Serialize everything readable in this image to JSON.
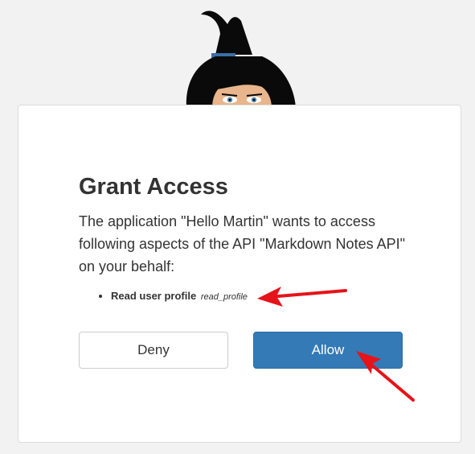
{
  "dialog": {
    "title": "Grant Access",
    "description": "The application \"Hello Martin\" wants to access following aspects of the API \"Markdown Notes API\" on your behalf:",
    "scopes": [
      {
        "name": "Read user profile",
        "id": "read_profile"
      }
    ],
    "deny_label": "Deny",
    "allow_label": "Allow"
  },
  "mascot": {
    "icon": "wizard-mascot-icon"
  },
  "annotations": {
    "icon": "red-arrow-icon"
  },
  "colors": {
    "background": "#f2f2f2",
    "card": "#ffffff",
    "allow_button": "#337ab7",
    "annotation_arrow": "#e5141a"
  }
}
